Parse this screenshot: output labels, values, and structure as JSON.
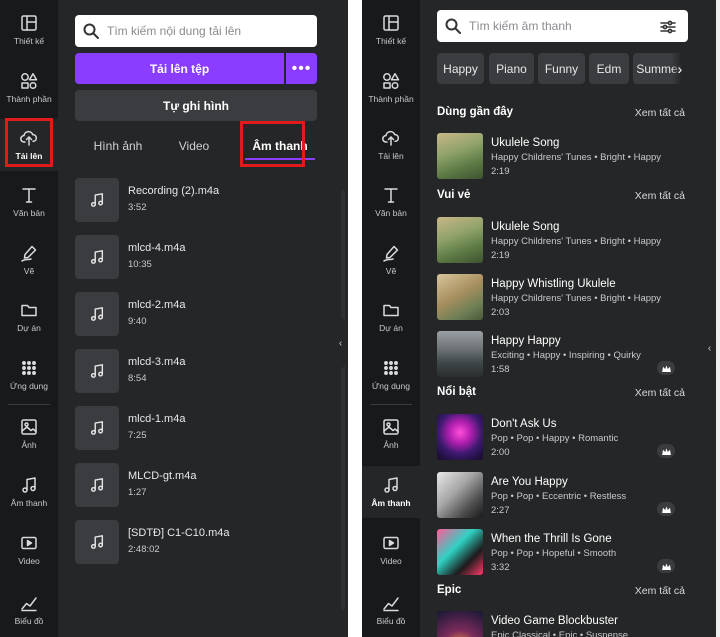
{
  "rail_left": [
    {
      "id": "design",
      "label": "Thiết kế",
      "icon": "layout-icon"
    },
    {
      "id": "elements",
      "label": "Thành phần",
      "icon": "shapes-icon"
    },
    {
      "id": "uploads",
      "label": "Tải lên",
      "icon": "cloud-upload-icon",
      "active": true
    },
    {
      "id": "text",
      "label": "Văn bản",
      "icon": "text-icon"
    },
    {
      "id": "draw",
      "label": "Vẽ",
      "icon": "pen-icon"
    },
    {
      "id": "projects",
      "label": "Dự án",
      "icon": "folder-icon"
    },
    {
      "id": "apps",
      "label": "Ứng dụng",
      "icon": "apps-grid-icon"
    },
    {
      "id": "photos",
      "label": "Ảnh",
      "icon": "image-icon"
    },
    {
      "id": "audio",
      "label": "Âm thanh",
      "icon": "music-note-icon"
    },
    {
      "id": "video",
      "label": "Video",
      "icon": "video-icon"
    },
    {
      "id": "charts",
      "label": "Biểu đồ",
      "icon": "chart-icon"
    }
  ],
  "rail_right": [
    {
      "id": "design",
      "label": "Thiết kế",
      "icon": "layout-icon"
    },
    {
      "id": "elements",
      "label": "Thành phần",
      "icon": "shapes-icon"
    },
    {
      "id": "uploads",
      "label": "Tải lên",
      "icon": "cloud-upload-icon"
    },
    {
      "id": "text",
      "label": "Văn bản",
      "icon": "text-icon"
    },
    {
      "id": "draw",
      "label": "Vẽ",
      "icon": "pen-icon"
    },
    {
      "id": "projects",
      "label": "Dự án",
      "icon": "folder-icon"
    },
    {
      "id": "apps",
      "label": "Ứng dụng",
      "icon": "apps-grid-icon"
    },
    {
      "id": "photos",
      "label": "Ảnh",
      "icon": "image-icon"
    },
    {
      "id": "audio",
      "label": "Âm thanh",
      "icon": "music-note-icon",
      "active": true
    },
    {
      "id": "video",
      "label": "Video",
      "icon": "video-icon"
    },
    {
      "id": "charts",
      "label": "Biểu đồ",
      "icon": "chart-icon"
    }
  ],
  "uploads": {
    "search_placeholder": "Tìm kiếm nội dung tải lên",
    "upload_label": "Tải lên tệp",
    "more_label": "•••",
    "record_label": "Tự ghi hình",
    "tabs": [
      {
        "label": "Hình ảnh"
      },
      {
        "label": "Video"
      },
      {
        "label": "Âm thanh",
        "active": true
      }
    ],
    "files": [
      {
        "name": "Recording (2).m4a",
        "duration": "3:52"
      },
      {
        "name": "mlcd-4.m4a",
        "duration": "10:35"
      },
      {
        "name": "mlcd-2.m4a",
        "duration": "9:40"
      },
      {
        "name": "mlcd-3.m4a",
        "duration": "8:54"
      },
      {
        "name": "mlcd-1.m4a",
        "duration": "7:25"
      },
      {
        "name": "MLCD-gt.m4a",
        "duration": "1:27"
      },
      {
        "name": "[SDTĐ] C1-C10.m4a",
        "duration": "2:48:02"
      }
    ]
  },
  "audio": {
    "search_placeholder": "Tìm kiếm âm thanh",
    "chips": [
      "Happy",
      "Piano",
      "Funny",
      "Edm",
      "Summer"
    ],
    "see_all": "Xem tất cả",
    "sections": [
      {
        "title": "Dùng gần đây",
        "tracks": [
          {
            "title": "Ukulele Song",
            "meta": "Happy Childrens' Tunes • Bright • Happy",
            "duration": "2:19",
            "thumb": "ukulele",
            "pro": false
          }
        ]
      },
      {
        "title": "Vui vẻ",
        "tracks": [
          {
            "title": "Ukulele Song",
            "meta": "Happy Childrens' Tunes • Bright • Happy",
            "duration": "2:19",
            "thumb": "ukulele",
            "pro": false
          },
          {
            "title": "Happy Whistling Ukulele",
            "meta": "Happy Childrens' Tunes • Bright • Happy",
            "duration": "2:03",
            "thumb": "ukulele2",
            "pro": false
          },
          {
            "title": "Happy Happy",
            "meta": "Exciting • Happy • Inspiring • Quirky",
            "duration": "1:58",
            "thumb": "road",
            "pro": true
          }
        ]
      },
      {
        "title": "Nổi bật",
        "tracks": [
          {
            "title": "Don't Ask Us",
            "meta": "Pop • Pop • Happy • Romantic",
            "duration": "2:00",
            "thumb": "neon",
            "pro": true
          },
          {
            "title": "Are You Happy",
            "meta": "Pop • Pop • Eccentric • Restless",
            "duration": "2:27",
            "thumb": "bw",
            "pro": true
          },
          {
            "title": "When the Thrill Is Gone",
            "meta": "Pop • Pop • Hopeful • Smooth",
            "duration": "3:32",
            "thumb": "pink",
            "pro": true
          }
        ]
      },
      {
        "title": "Epic",
        "tracks": [
          {
            "title": "Video Game Blockbuster",
            "meta": "Epic Classical • Epic • Suspense",
            "duration": "",
            "thumb": "epic",
            "pro": false
          }
        ]
      }
    ]
  },
  "colors": {
    "accent": "#8b3dff",
    "highlight": "#e01b1b",
    "panel": "#252627",
    "rail": "#18191b"
  }
}
